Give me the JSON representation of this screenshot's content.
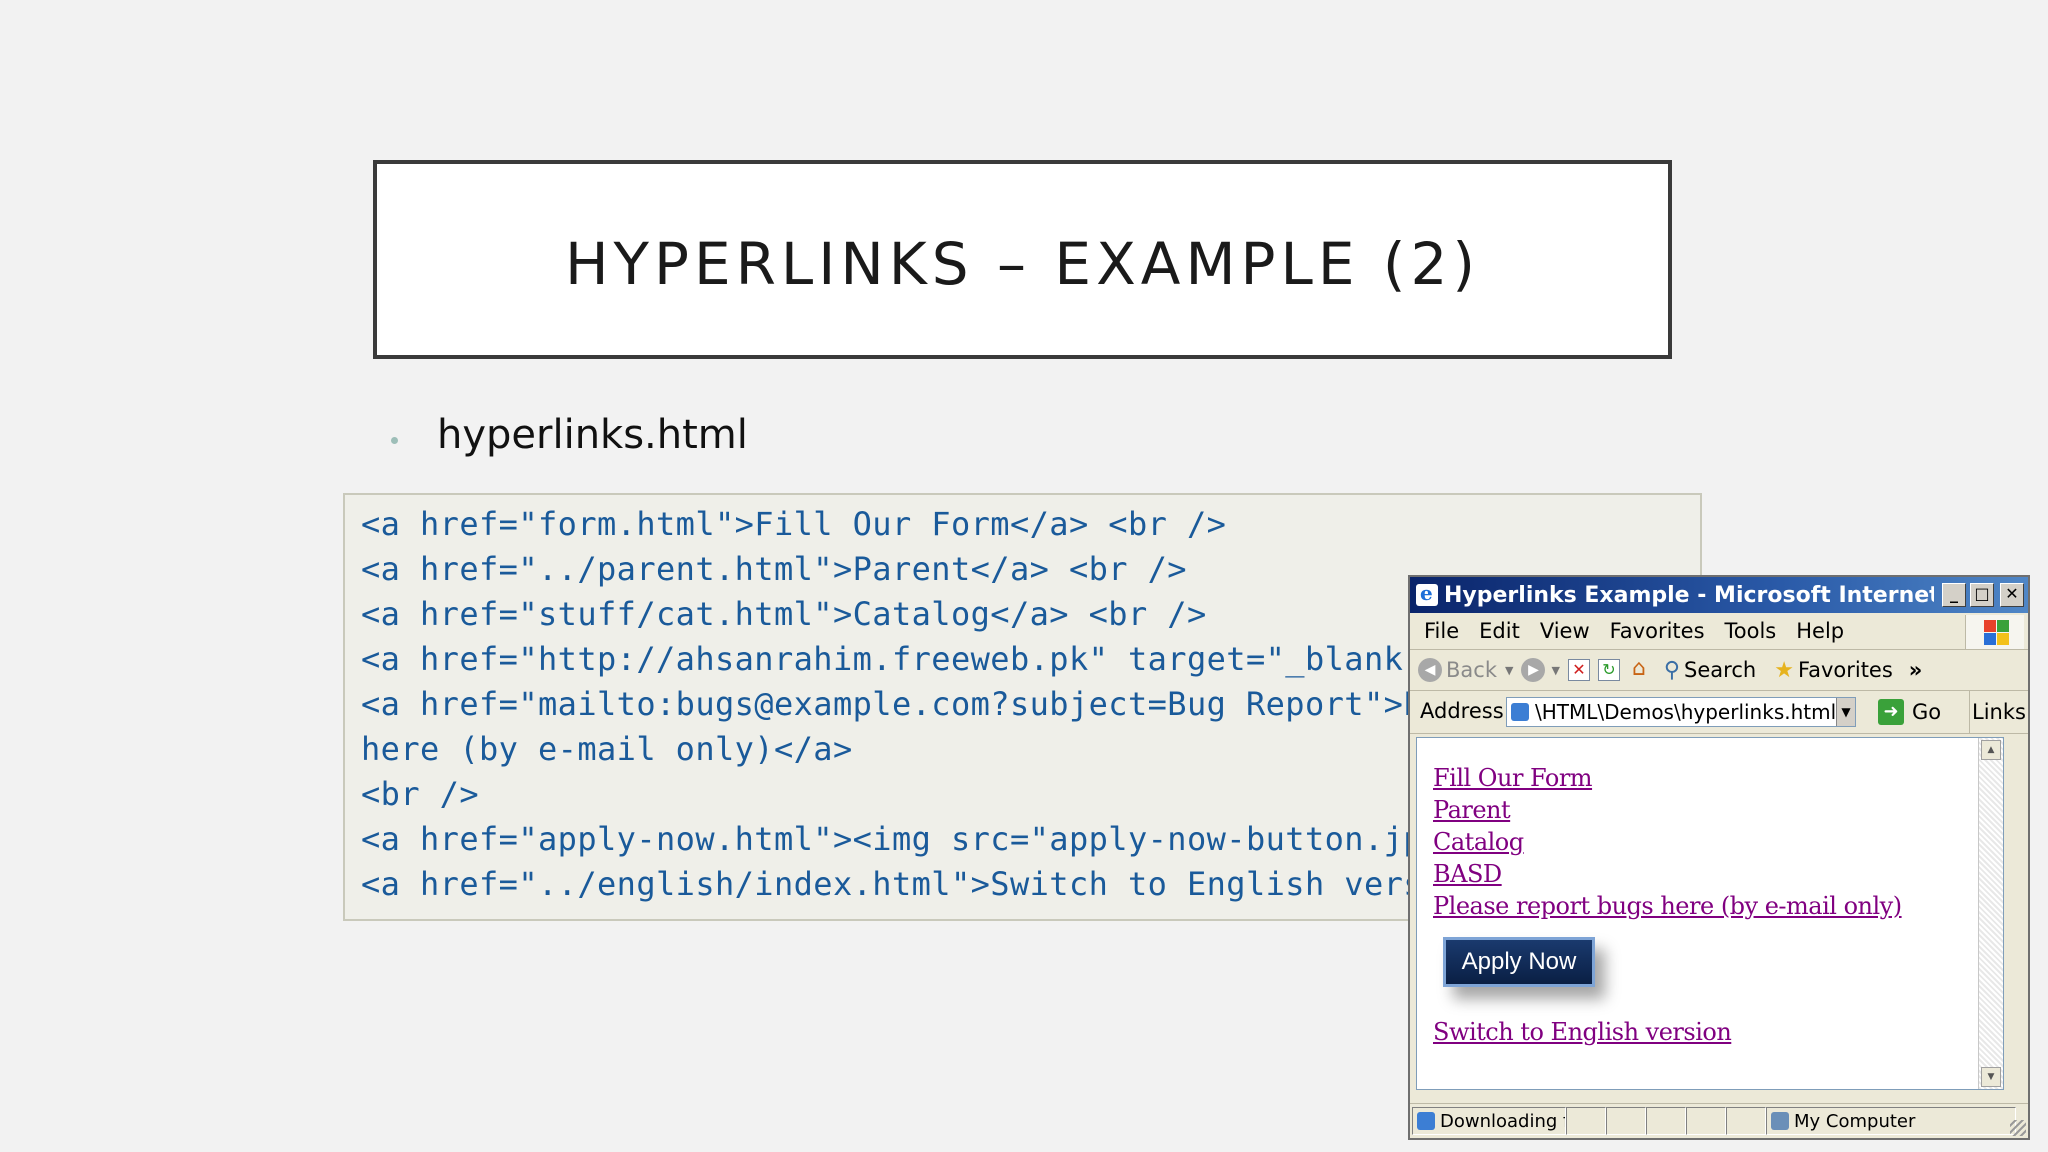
{
  "slide": {
    "title": "HYPERLINKS – EXAMPLE (2)",
    "bullet": "hyperlinks.html"
  },
  "code": {
    "lines": [
      "<a href=\"form.html\">Fill Our Form</a> <br />",
      "<a href=\"../parent.html\">Parent</a> <br />",
      "<a href=\"stuff/cat.html\">Catalog</a> <br />",
      "<a href=\"http://ahsanrahim.freeweb.pk\" target=\"_blank\">BASD</a> <br />",
      "<a href=\"mailto:bugs@example.com?subject=Bug Report\">Please report bugs",
      "here (by e-mail only)</a>",
      "<br />",
      "<a href=\"apply-now.html\"><img src=\"apply-now-button.jpg\" /></a>",
      "<a href=\"../english/index.html\">Switch to English version</a>"
    ]
  },
  "browser": {
    "title": "Hyperlinks Example - Microsoft Internet Expl...",
    "window_buttons": {
      "minimize": "_",
      "maximize": "□",
      "close": "✕"
    },
    "menu": [
      "File",
      "Edit",
      "View",
      "Favorites",
      "Tools",
      "Help"
    ],
    "toolbar": {
      "back": "Back",
      "search": "Search",
      "favorites": "Favorites",
      "more": "»"
    },
    "address": {
      "label": "Address",
      "value": "\\HTML\\Demos\\hyperlinks.html",
      "go": "Go",
      "links": "Links"
    },
    "page": {
      "links": [
        "Fill Our Form",
        "Parent",
        "Catalog",
        "BASD",
        "Please report bugs here (by e-mail only)"
      ],
      "apply_button": "Apply Now",
      "last_link": "Switch to English version"
    },
    "status": {
      "text": "Downloading f",
      "zone": "My Computer"
    }
  }
}
